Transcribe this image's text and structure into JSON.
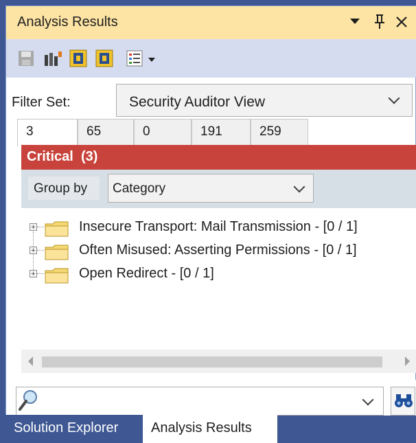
{
  "window": {
    "title": "Analysis Results",
    "buttons": {
      "dropdown_icon": "triangle-down-icon",
      "pin_glyph": "ᴥ0",
      "close_glyph": "×"
    }
  },
  "toolbar": {
    "items": [
      {
        "icon": "save-icon"
      },
      {
        "icon": "audit-workbench-icon"
      },
      {
        "icon": "fortify-icon"
      },
      {
        "icon": "fortify-icon"
      },
      {
        "icon": "report-list-icon"
      }
    ]
  },
  "filter": {
    "label": "Filter Set:",
    "value": "Security Auditor View"
  },
  "tabs": [
    {
      "label": "3"
    },
    {
      "label": "65"
    },
    {
      "label": "0"
    },
    {
      "label": "191"
    },
    {
      "label": "259"
    }
  ],
  "severity": {
    "label": "Critical",
    "count": "(3)",
    "color": "#c8433b"
  },
  "group": {
    "button_label": "Group by",
    "value": "Category"
  },
  "tree": {
    "items": [
      {
        "label": "Insecure Transport: Mail Transmission - [0 / 1]"
      },
      {
        "label": "Often Misused: Asserting Permissions - [0 / 1]"
      },
      {
        "label": "Open Redirect - [0 / 1]"
      }
    ]
  },
  "bottom_tabs": [
    {
      "label": "Solution Explorer"
    },
    {
      "label": "Analysis Results"
    }
  ],
  "colors": {
    "title_bar": "#fde4a4",
    "toolbar": "#d5dcef",
    "frame": "#3f5893"
  }
}
